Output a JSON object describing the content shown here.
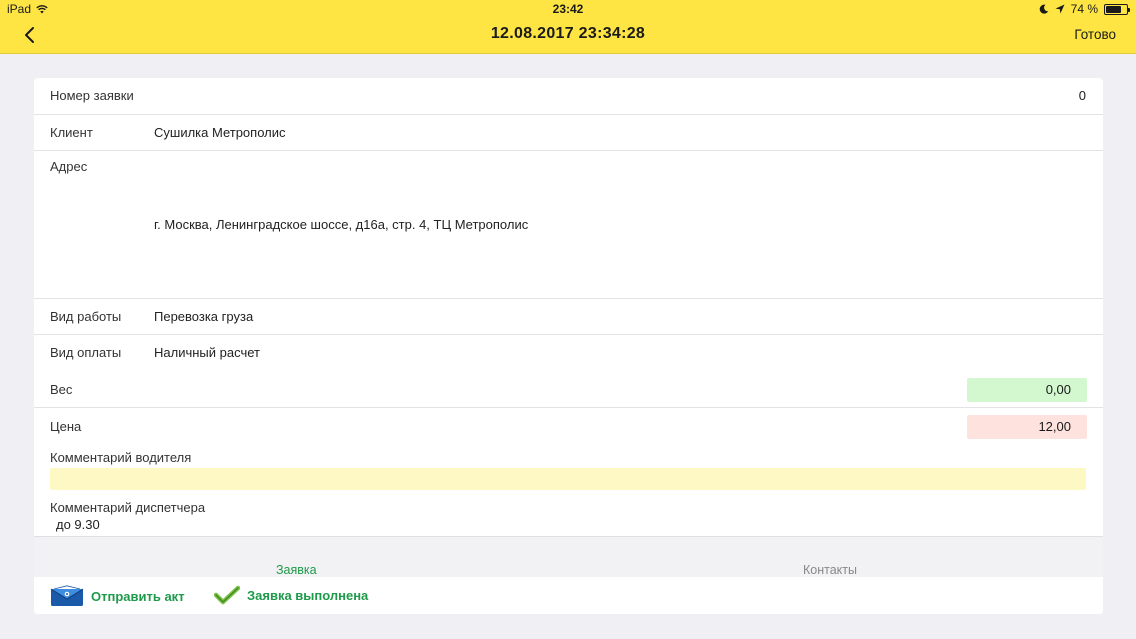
{
  "status_bar": {
    "carrier": "iPad",
    "time": "23:42",
    "battery_percent": "74 %",
    "battery_level": 0.74
  },
  "nav": {
    "title": "12.08.2017 23:34:28",
    "done_label": "Готово"
  },
  "form": {
    "order_number": {
      "label": "Номер заявки",
      "value": "0"
    },
    "client": {
      "label": "Клиент",
      "value": "Сушилка Метрополис"
    },
    "address": {
      "label": "Адрес",
      "value": "г. Москва, Ленинградское шоссе, д16а, стр. 4, ТЦ Метрополис"
    },
    "work_type": {
      "label": "Вид работы",
      "value": "Перевозка груза"
    },
    "payment_type": {
      "label": "Вид оплаты",
      "value": "Наличный расчет"
    },
    "weight": {
      "label": "Вес",
      "value": "0,00"
    },
    "price": {
      "label": "Цена",
      "value": "12,00"
    },
    "driver_comment": {
      "label": "Комментарий водителя",
      "value": ""
    },
    "dispatcher_comment": {
      "label": "Комментарий диспетчера",
      "value": "до 9.30"
    }
  },
  "tabs": [
    {
      "label": "Заявка",
      "active": true
    },
    {
      "label": "Контакты",
      "active": false
    }
  ],
  "actions": {
    "send_act": "Отправить акт",
    "order_done": "Заявка выполнена"
  },
  "colors": {
    "header_bg": "#fee543",
    "accent_green": "#1e9a4a",
    "weight_bg": "#d3f8cf",
    "price_bg": "#fde2de",
    "comment_bg": "#fdf8c4"
  }
}
